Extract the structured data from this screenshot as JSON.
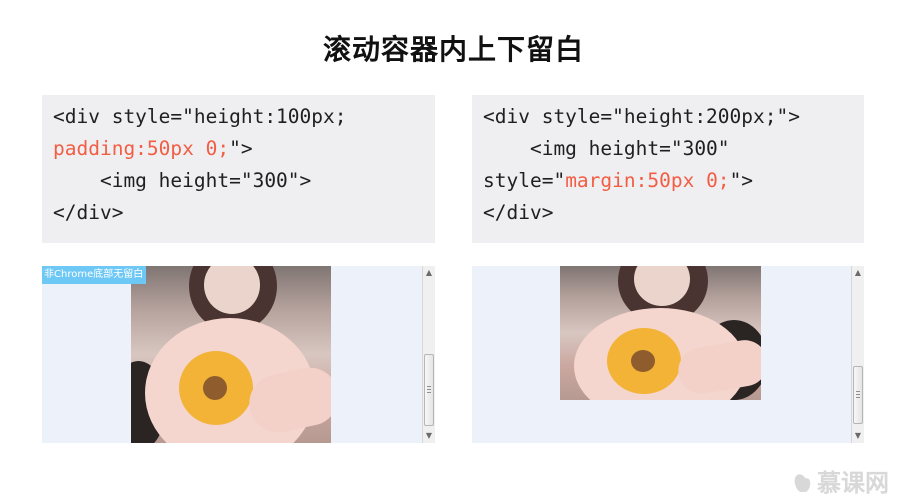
{
  "title": "滚动容器内上下留白",
  "left_code": {
    "line1": "<div style=\"height:100px;",
    "line2_highlight": "padding:50px 0;",
    "line2_rest": "\">",
    "line3": "    <img height=\"300\">",
    "line4": "</div>"
  },
  "right_code": {
    "line1": "<div style=\"height:200px;\">",
    "line2": "    <img height=\"300\"",
    "line3_prefix": "style=\"",
    "line3_highlight": "margin:50px 0;",
    "line3_rest": "\">",
    "line4": "</div>"
  },
  "left_demo": {
    "badge": "非Chrome底部无留白"
  },
  "brand": {
    "text": "慕课网"
  },
  "colors": {
    "highlight": "#f25d44",
    "code_background": "#efeff1",
    "demo_background": "#edf1fa",
    "badge_background": "#6ec8f6"
  },
  "icons": {
    "scroll_up": "triangle-up-icon",
    "scroll_down": "triangle-down-icon",
    "brand": "flame-logo-icon"
  }
}
